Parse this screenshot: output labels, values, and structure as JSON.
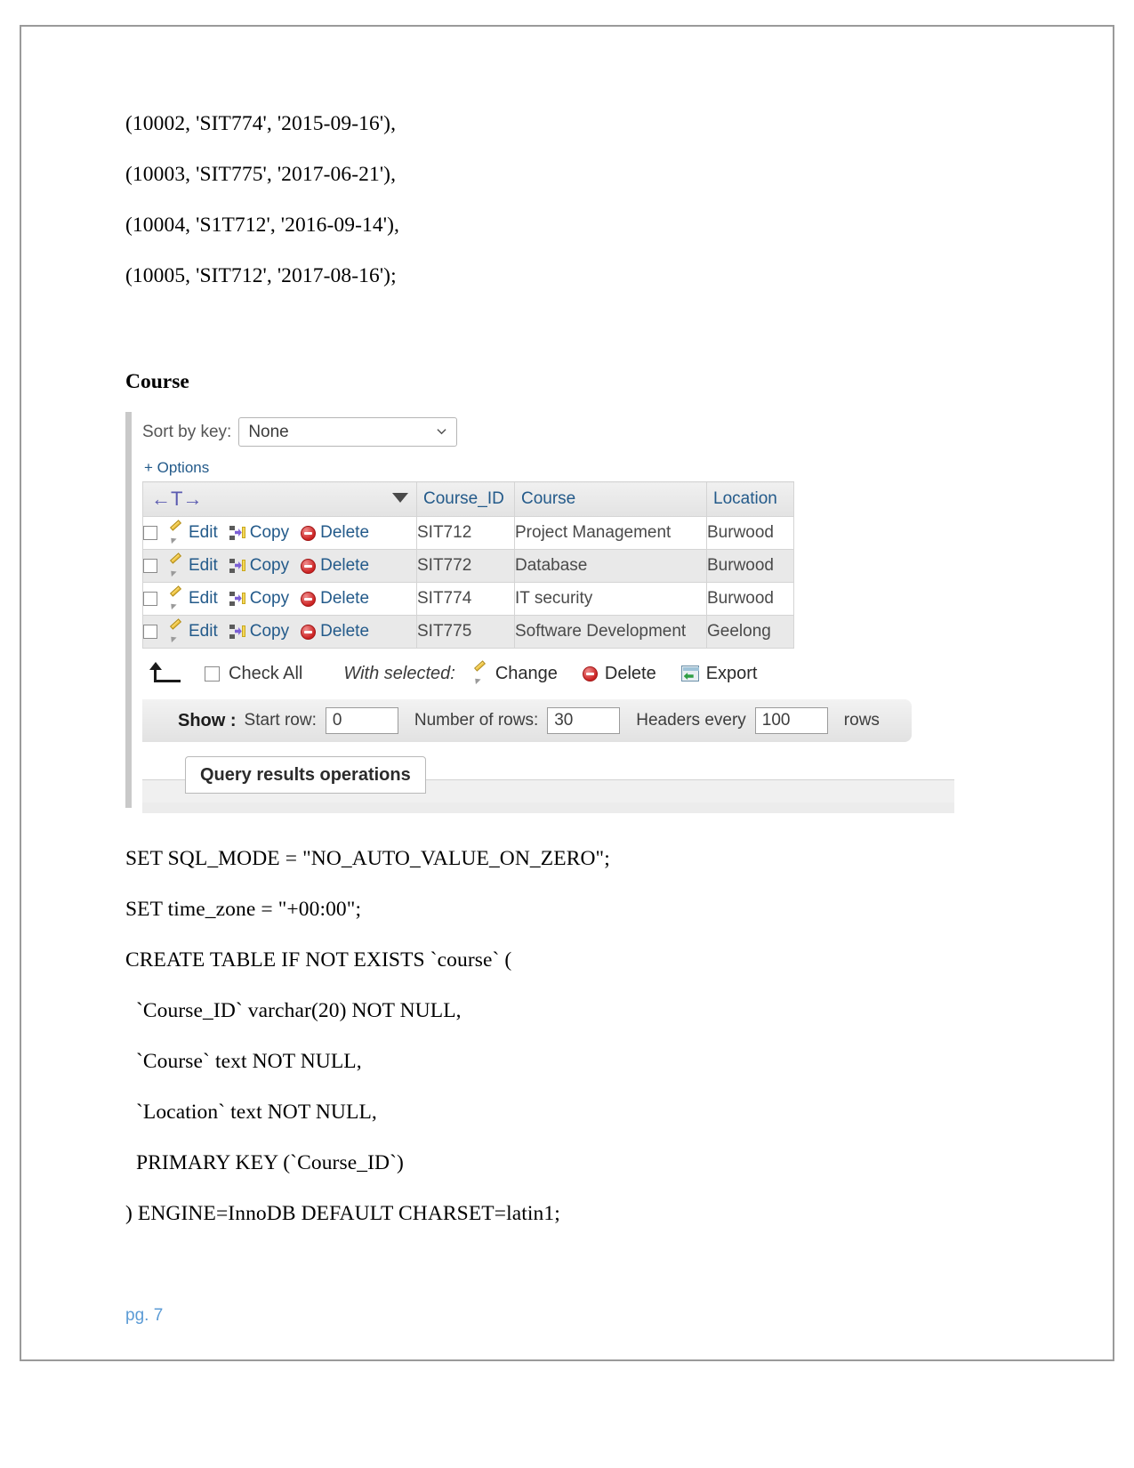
{
  "document": {
    "insert_lines": [
      "(10002, 'SIT774', '2015-09-16'),",
      "(10003, 'SIT775', '2017-06-21'),",
      "(10004, 'S1T712', '2016-09-14'),",
      "(10005, 'SIT712', '2017-08-16');"
    ],
    "section_heading": "Course",
    "sql_lines": [
      "SET SQL_MODE = \"NO_AUTO_VALUE_ON_ZERO\";",
      "SET time_zone = \"+00:00\";",
      "CREATE TABLE IF NOT EXISTS `course` (",
      "  `Course_ID` varchar(20) NOT NULL,",
      "  `Course` text NOT NULL,",
      "  `Location` text NOT NULL,",
      "  PRIMARY KEY (`Course_ID`)",
      ") ENGINE=InnoDB DEFAULT CHARSET=latin1;"
    ],
    "page_number": "pg. 7"
  },
  "phpmyadmin": {
    "sort_by_key": {
      "label": "Sort by key:",
      "value": "None"
    },
    "options_link": "+ Options",
    "nav_arrows": "←T→",
    "columns": [
      {
        "key": "actions",
        "label": ""
      },
      {
        "key": "course_id",
        "label": "Course_ID"
      },
      {
        "key": "course",
        "label": "Course"
      },
      {
        "key": "location",
        "label": "Location"
      }
    ],
    "row_actions": {
      "edit": "Edit",
      "copy": "Copy",
      "delete": "Delete"
    },
    "rows": [
      {
        "course_id": "SIT712",
        "course": "Project Management",
        "location": "Burwood"
      },
      {
        "course_id": "SIT772",
        "course": "Database",
        "location": "Burwood"
      },
      {
        "course_id": "SIT774",
        "course": "IT security",
        "location": "Burwood"
      },
      {
        "course_id": "SIT775",
        "course": "Software Development",
        "location": "Geelong"
      }
    ],
    "with_selected": {
      "check_all": "Check All",
      "label": "With selected:",
      "change": "Change",
      "delete": "Delete",
      "export": "Export"
    },
    "show_bar": {
      "show_label": "Show :",
      "start_row_label": "Start row:",
      "start_row_value": "0",
      "number_of_rows_label": "Number of rows:",
      "number_of_rows_value": "30",
      "headers_every_label": "Headers every",
      "headers_every_value": "100",
      "rows_suffix": "rows"
    },
    "query_results_operations_tab": "Query results operations",
    "colors": {
      "link_blue": "#235a8a",
      "header_bg": "#e9e9e9",
      "alt_row_bg": "#e9e9e9"
    }
  }
}
